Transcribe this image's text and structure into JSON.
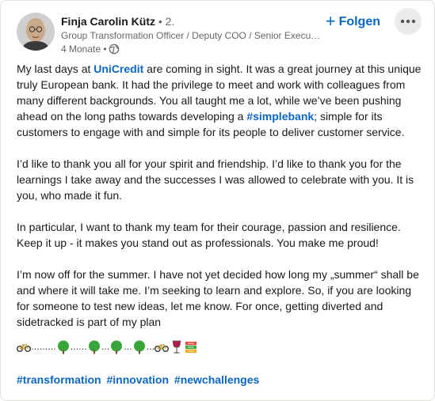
{
  "author": {
    "name": "Finja Carolin Kütz",
    "degree": "• 2.",
    "headline": "Group Transformation Officer / Deputy COO / Senior Execut…",
    "time": "4 Monate •"
  },
  "actions": {
    "follow_label": "Folgen",
    "follow_icon": "plus-icon",
    "more_icon": "more-icon"
  },
  "post": {
    "p1_pre": "My last days at ",
    "p1_link": "UniCredit",
    "p1_mid": " are coming in sight. It was a great journey at this unique truly European bank. It had the privilege to meet and work with colleagues from many different backgrounds. You all taught me a lot, while we’ve been pushing ahead on the long paths towards developing a ",
    "p1_hashtag": "#simplebank",
    "p1_post": "; simple for its customers to engage with and simple for its people to deliver customer service.",
    "p2": "I’d like to thank you all for your spirit and friendship. I’d like to thank you for the learnings I take away and the successes I was allowed to celebrate with you. It is you, who made it fun.",
    "p3": "In particular, I want to thank my team for their courage, passion and resilience. Keep it up - it makes you stand out as professionals. You make me proud!",
    "p4": "I’m now off for the summer. I have not yet decided how long my „summer“ shall be and where it will take me. I’m seeking to learn and explore. So, if you are looking for someone to test new ideas, let me know. For once, getting diverted and sidetracked is part of my plan",
    "dots1": "………",
    "dots2": "……",
    "dots3": "…",
    "dots4": "…",
    "dots5": "…",
    "hashtags": [
      "#transformation",
      "#innovation",
      "#newchallenges"
    ]
  },
  "colors": {
    "link": "#0a66c2",
    "text": "#191919",
    "muted": "#666666"
  }
}
